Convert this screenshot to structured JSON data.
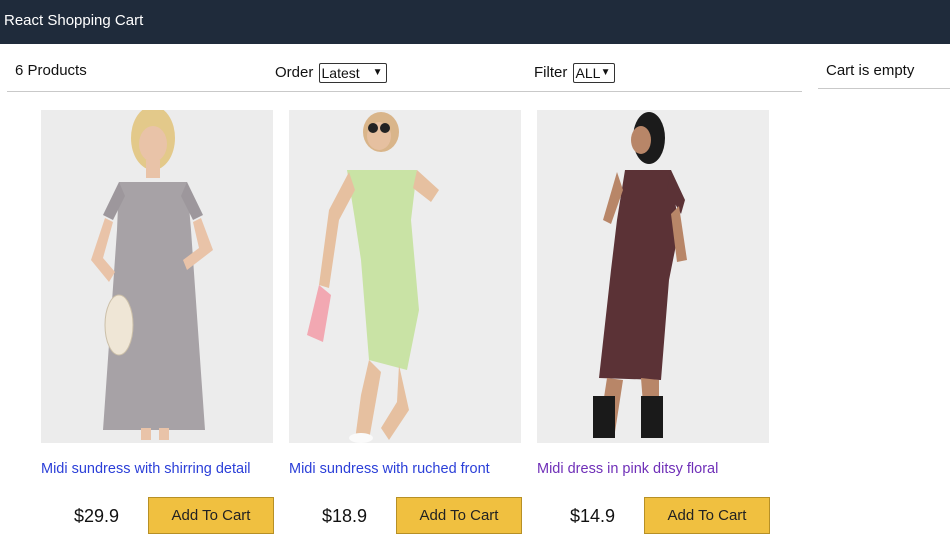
{
  "header": {
    "title": "React Shopping Cart"
  },
  "filters": {
    "count_label": "6 Products",
    "order_label": "Order",
    "order_value": "Latest",
    "filter_label": "Filter",
    "filter_value": "ALL"
  },
  "cart": {
    "status": "Cart is empty"
  },
  "products": [
    {
      "title": "Midi sundress with shirring detail",
      "price": "$29.9",
      "button": "Add To Cart",
      "dress_color": "#a7a2a6",
      "image": "woman-in-grey-floral-midi-dress"
    },
    {
      "title": "Midi sundress with ruched front",
      "price": "$18.9",
      "button": "Add To Cart",
      "dress_color": "#c9e3a5",
      "image": "woman-in-green-midi-dress"
    },
    {
      "title": "Midi dress in pink ditsy floral",
      "price": "$14.9",
      "button": "Add To Cart",
      "dress_color": "#5b3236",
      "image": "woman-in-dark-floral-midi-dress"
    }
  ],
  "colors": {
    "header_bg": "#1f2b3b",
    "button_bg": "#f0c040",
    "link": "#2b3fd8",
    "visited_link": "#6f2fb8"
  }
}
